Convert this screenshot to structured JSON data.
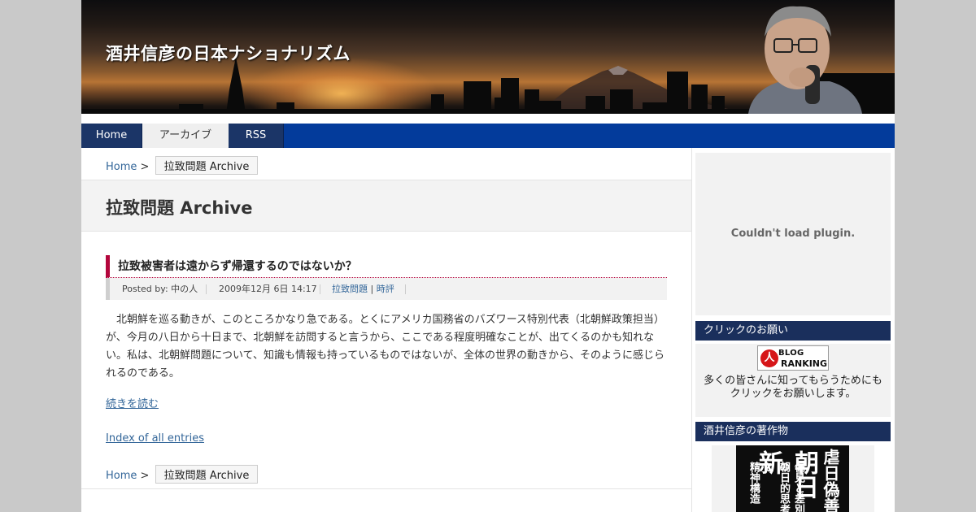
{
  "header": {
    "site_title": "酒井信彦の日本ナショナリズム"
  },
  "nav": {
    "home": "Home",
    "archive": "アーカイブ",
    "rss": "RSS"
  },
  "breadcrumb": {
    "home": "Home",
    "separator": ">",
    "current": "拉致問題 Archive"
  },
  "archive": {
    "title": "拉致問題 Archive"
  },
  "entry": {
    "title": "拉致被害者は遠からず帰還するのではないか？",
    "meta": {
      "posted_by_label": "Posted by:",
      "author": "中の人",
      "datetime": "2009年12月 6日 14:17",
      "categories": [
        "拉致問題",
        "時評"
      ],
      "category_separator": "|"
    },
    "body": "　北朝鮮を巡る動きが、このところかなり急である。とくにアメリカ国務省のバズワース特別代表（北朝鮮政策担当）が、今月の八日から十日まで、北朝鮮を訪問すると言うから、ここである程度明確なことが、出てくるのかも知れない。私は、北朝鮮問題について、知識も情報も持っているものではないが、全体の世界の動きから、そのように感じられるのである。",
    "read_more": "続きを読む"
  },
  "index_link": "Index of all entries",
  "sidebar": {
    "plugin_message": "Couldn't load plugin.",
    "click_heading": "クリックのお願い",
    "ranking_badge": {
      "logo_letter": "人",
      "line1": "BLOG",
      "line2": "RANKING"
    },
    "click_text": "多くの皆さんに知ってもらうためにも\nクリックをお願いします。",
    "works_heading": "酒井信彦の著作物",
    "book": {
      "title_main": "虐日偽善",
      "title_sub": "朝日新",
      "subtitle_1": "偏見と差別の",
      "subtitle_2": "朝日的思考と",
      "subtitle_3": "精神構造"
    }
  },
  "colors": {
    "nav_bar": "#033b9b",
    "nav_tab_dark": "#1b3567",
    "sidebar_heading": "#1a2f5c",
    "title_accent": "#b3063c",
    "link": "#336699"
  }
}
